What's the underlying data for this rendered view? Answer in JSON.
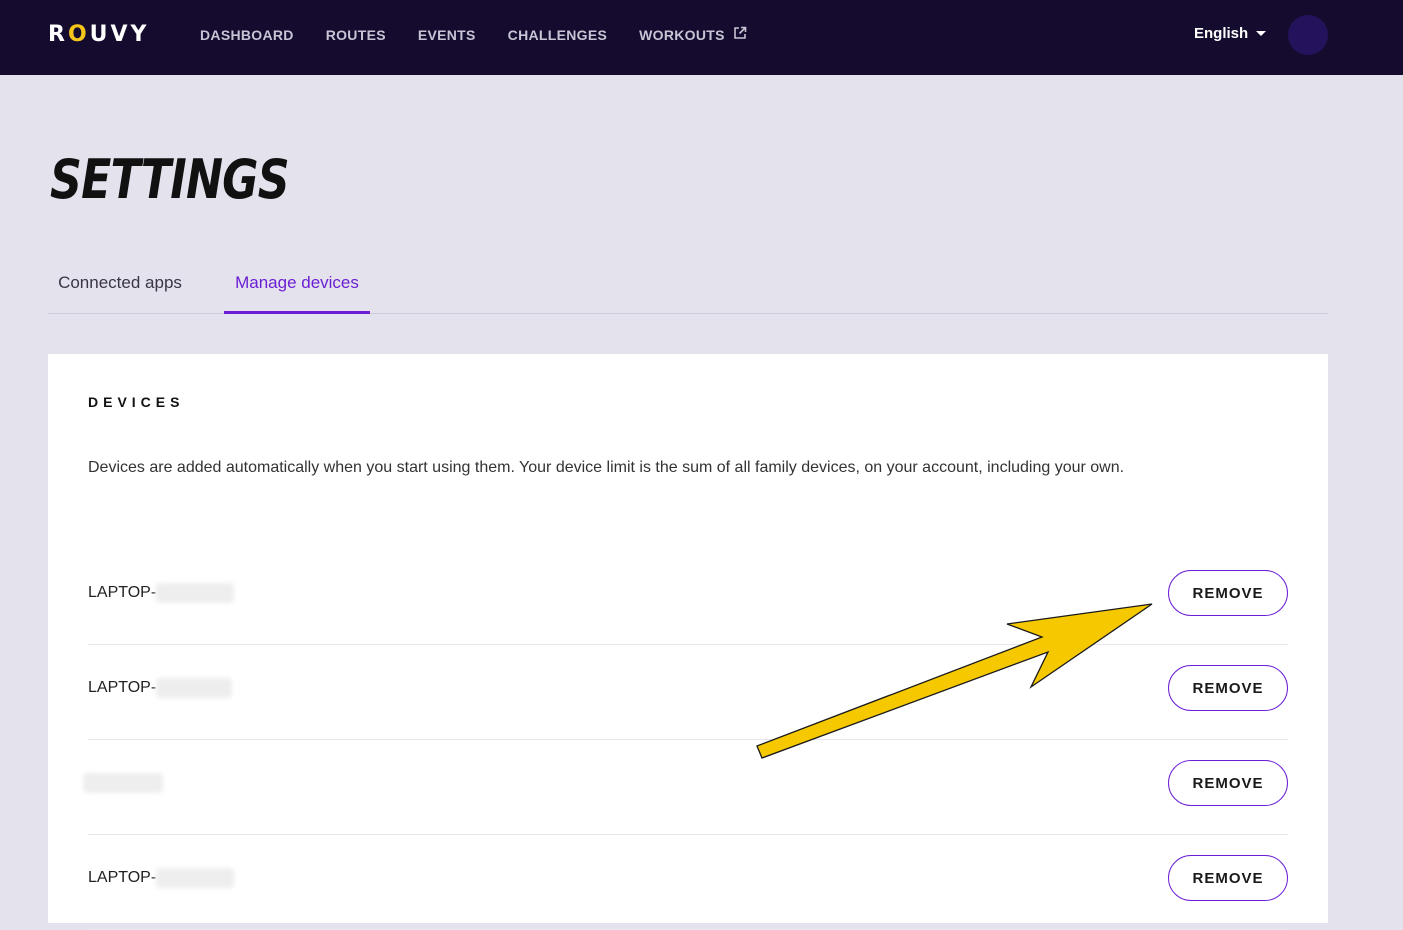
{
  "header": {
    "logo_text": "ROUVY",
    "nav": [
      {
        "label": "DASHBOARD"
      },
      {
        "label": "ROUTES"
      },
      {
        "label": "EVENTS"
      },
      {
        "label": "CHALLENGES"
      },
      {
        "label": "WORKOUTS",
        "icon": "external-link-icon"
      }
    ],
    "language": "English"
  },
  "page": {
    "title": "SETTINGS",
    "tabs": [
      {
        "label": "Connected apps",
        "active": false
      },
      {
        "label": "Manage devices",
        "active": true
      }
    ]
  },
  "devices": {
    "heading": "DEVICES",
    "description": "Devices are added automatically when you start using them. Your device limit is the sum of all family devices, on your account, including your own.",
    "remove_label": "REMOVE",
    "items": [
      {
        "name": "LAPTOP-"
      },
      {
        "name": "LAPTOP-"
      },
      {
        "name": ""
      },
      {
        "name": "LAPTOP-"
      }
    ]
  },
  "colors": {
    "header_bg": "#140b2e",
    "accent": "#6b1fd4",
    "annotation_arrow": "#f5c800"
  }
}
